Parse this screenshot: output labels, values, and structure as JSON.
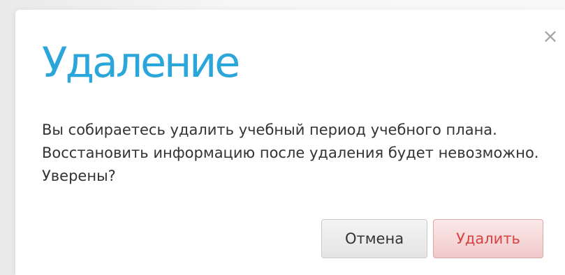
{
  "dialog": {
    "title": "Удаление",
    "message": "Вы собираетесь удалить учебный период учебного плана. Восстановить информацию после удаления будет невозможно. Уверены?",
    "close_icon": "×",
    "buttons": {
      "cancel_label": "Отмена",
      "delete_label": "Удалить"
    },
    "colors": {
      "title": "#2aa6da",
      "delete_text": "#d64343",
      "delete_bg": "#f0c9c9",
      "cancel_bg": "#e4e4e4"
    }
  }
}
